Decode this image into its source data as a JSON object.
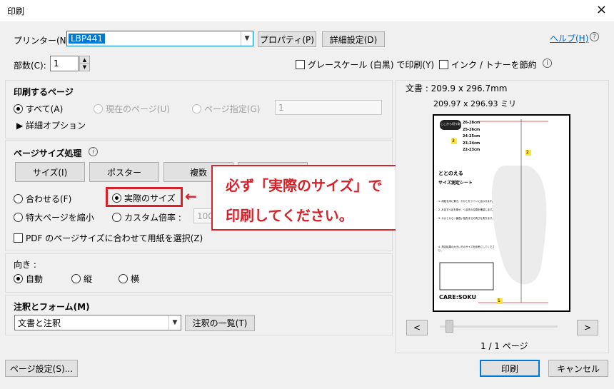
{
  "window": {
    "title": "印刷",
    "close_icon": "×"
  },
  "printer": {
    "label": "プリンター(N):",
    "value": "LBP441",
    "properties_button": "プロパティ(P)",
    "advanced_button": "詳細設定(D)",
    "help_link": "ヘルプ(H)"
  },
  "copies": {
    "label": "部数(C):",
    "value": "1",
    "grayscale_label": "グレースケール (白黒) で印刷(Y)",
    "save_ink_label": "インク / トナーを節約"
  },
  "pages_to_print": {
    "title": "印刷するページ",
    "all_label": "すべて(A)",
    "current_label": "現在のページ(U)",
    "range_label": "ページ指定(G)",
    "range_value": "1",
    "more_options_label": "▶ 詳細オプション"
  },
  "page_sizing": {
    "title": "ページサイズ処理",
    "size_button": "サイズ(I)",
    "poster_button": "ポスター",
    "multiple_button": "複数",
    "fit_label": "合わせる(F)",
    "actual_size_label": "実際のサイズ",
    "shrink_label": "特大ページを縮小",
    "custom_scale_label": "カスタム倍率 :",
    "custom_scale_value": "100",
    "pdf_paper_label": "PDF のページサイズに合わせて用紙を選択(Z)"
  },
  "callout": {
    "line1": "必ず「実際のサイズ」で",
    "line2": "印刷してください。",
    "arrow": "←"
  },
  "orientation": {
    "title": "向き :",
    "auto_label": "自動",
    "portrait_label": "縦",
    "landscape_label": "横"
  },
  "comments_forms": {
    "title": "注釈とフォーム(M)",
    "value": "文書と注釈",
    "summary_button": "注釈の一覧(T)"
  },
  "preview": {
    "doc_size": "文書 : 209.9 x 296.7mm",
    "paper_size": "209.97 x 296.93 ミリ",
    "page_counter": "1 / 1 ページ",
    "prev_button": "<",
    "next_button": ">",
    "page_contents": {
      "badge": "ここから切り取る",
      "sizes": [
        "26-28cm",
        "25-26cm",
        "24-25cm",
        "23-24cm",
        "22-23cm"
      ],
      "marker_3": "3",
      "marker_2": "2",
      "marker_1": "1",
      "brand_line": "ととのえる",
      "sheet_title": "サイズ測定シート",
      "step1": "1. 用紙を床に置き、かかとをラインに合わせます。",
      "step2": "2. 片足ずつ足を乗せ、つま先の位置を確認します。",
      "step3": "3. かかとから一番長い指先までの長さを測ります。",
      "step4": "4. 測定結果の大きい方のサイズを参考にしてください。",
      "logo": "CARE:SOKU"
    }
  },
  "footer": {
    "page_setup_button": "ページ設定(S)...",
    "print_button": "印刷",
    "cancel_button": "キャンセル"
  },
  "colors": {
    "accent_red": "#d8222a",
    "selection_blue": "#0078d7",
    "link_blue": "#0066cc"
  }
}
